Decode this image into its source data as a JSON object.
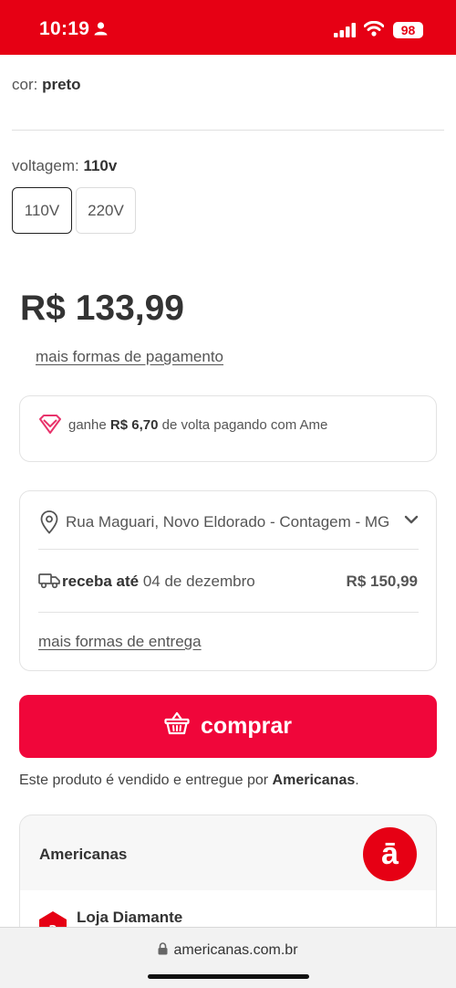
{
  "status_bar": {
    "time": "10:19",
    "battery": "98"
  },
  "product": {
    "color_label": "cor: ",
    "color_value": "preto",
    "voltage_label": "voltagem: ",
    "voltage_value": "110v",
    "voltage_options": [
      {
        "label": "110V",
        "selected": true
      },
      {
        "label": "220V",
        "selected": false
      }
    ],
    "price": "R$ 133,99",
    "payment_link": "mais formas de pagamento"
  },
  "ame": {
    "prefix": "ganhe ",
    "amount": "R$ 6,70",
    "suffix": " de volta pagando com Ame"
  },
  "shipping": {
    "address": "Rua Maguari, Novo Eldorado - Contagem - MG",
    "receive_label": "receba até",
    "receive_date": " 04 de dezembro",
    "price": "R$ 150,99",
    "more_link": "mais formas de entrega"
  },
  "buy_button": {
    "label": "comprar"
  },
  "sold_by": {
    "prefix": "Este produto é vendido e entregue por ",
    "seller": "Americanas",
    "suffix": "."
  },
  "seller_card": {
    "name": "Americanas",
    "logo_letter": "ā",
    "level": "Loja Diamante"
  },
  "browser": {
    "url": "americanas.com.br"
  },
  "colors": {
    "brand_red": "#e60014",
    "buy_button": "#f0063a",
    "ame_pink": "#e8336b"
  }
}
